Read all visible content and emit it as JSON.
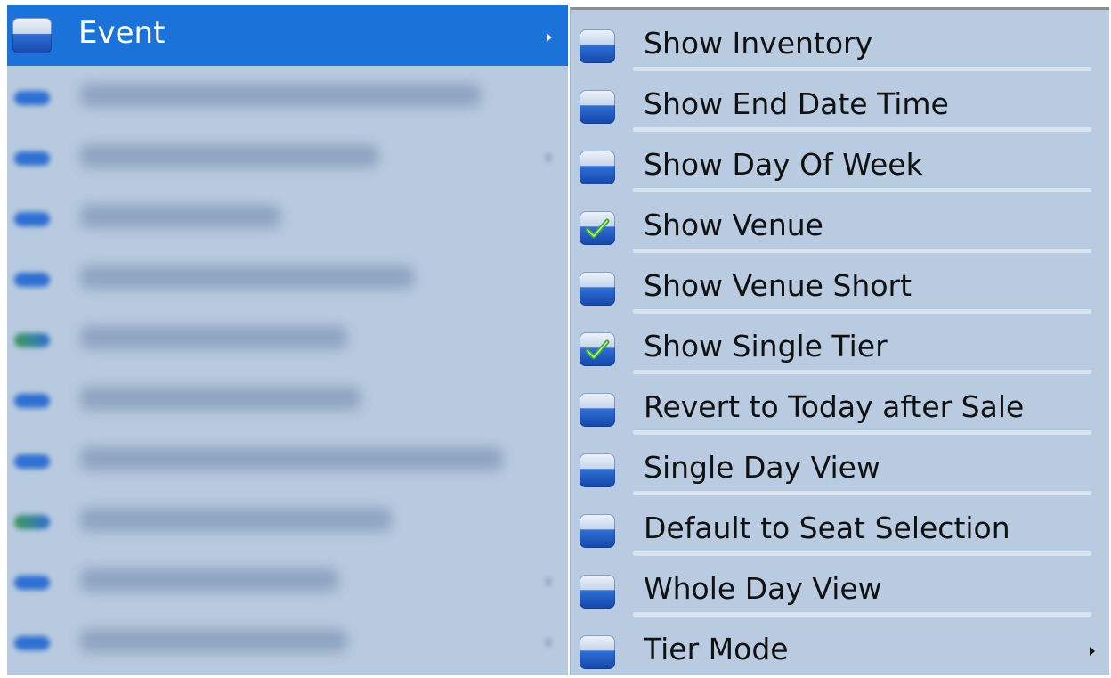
{
  "left_menu": {
    "highlighted_item": {
      "label": "Event",
      "icon": "checkbox-unchecked-icon",
      "has_submenu": true
    },
    "obscured_items": [
      {
        "icon": "checkbox-unchecked-icon",
        "has_submenu": false
      },
      {
        "icon": "checkbox-unchecked-icon",
        "has_submenu": true
      },
      {
        "icon": "checkbox-unchecked-icon",
        "has_submenu": false
      },
      {
        "icon": "checkbox-unchecked-icon",
        "has_submenu": false
      },
      {
        "icon": "checkbox-checked-icon",
        "has_submenu": false
      },
      {
        "icon": "checkbox-unchecked-icon",
        "has_submenu": false
      },
      {
        "icon": "checkbox-unchecked-icon",
        "has_submenu": false
      },
      {
        "icon": "checkbox-checked-icon",
        "has_submenu": false
      },
      {
        "icon": "checkbox-unchecked-icon",
        "has_submenu": true
      },
      {
        "icon": "checkbox-unchecked-icon",
        "has_submenu": true
      }
    ]
  },
  "submenu": {
    "items": [
      {
        "label": "Show Inventory",
        "checked": false,
        "has_submenu": false
      },
      {
        "label": "Show End Date Time",
        "checked": false,
        "has_submenu": false
      },
      {
        "label": "Show Day Of Week",
        "checked": false,
        "has_submenu": false
      },
      {
        "label": "Show Venue",
        "checked": true,
        "has_submenu": false
      },
      {
        "label": "Show Venue Short",
        "checked": false,
        "has_submenu": false
      },
      {
        "label": "Show Single Tier",
        "checked": true,
        "has_submenu": false
      },
      {
        "label": "Revert to Today after Sale",
        "checked": false,
        "has_submenu": false
      },
      {
        "label": "Single Day View",
        "checked": false,
        "has_submenu": false
      },
      {
        "label": "Default to Seat Selection",
        "checked": false,
        "has_submenu": false
      },
      {
        "label": "Whole Day View",
        "checked": false,
        "has_submenu": false
      },
      {
        "label": "Tier Mode",
        "checked": false,
        "has_submenu": true
      }
    ]
  },
  "colors": {
    "menu_background": "#b8cadf",
    "highlight": "#1b73d9",
    "checkmark": "#3aa83a"
  }
}
